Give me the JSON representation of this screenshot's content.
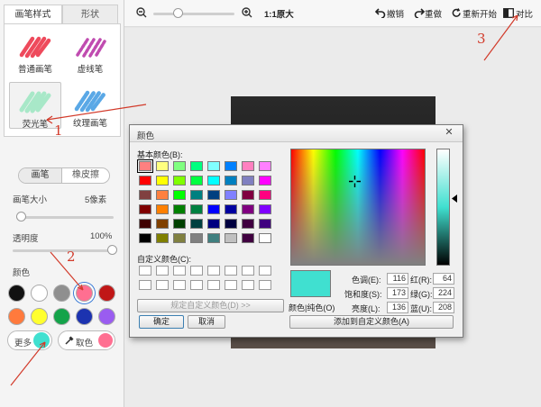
{
  "left_panel": {
    "tabs": [
      "画笔样式",
      "形状"
    ],
    "pens": [
      {
        "label": "普通画笔",
        "color": "#ee4a5c"
      },
      {
        "label": "虚线笔",
        "color": "#c04cb0"
      },
      {
        "label": "荧光笔",
        "color": "#a8e8c8"
      },
      {
        "label": "纹理画笔",
        "color": "#5aa8e6"
      }
    ],
    "mode_tabs": [
      "画笔",
      "橡皮擦"
    ],
    "size_label": "画笔大小",
    "size_value": "5像素",
    "size_fraction": 0.05,
    "opacity_label": "透明度",
    "opacity_value": "100%",
    "opacity_fraction": 1.0,
    "color_label": "颜色",
    "swatches": [
      "#111111",
      "#ffffff",
      "#8f8f8f",
      "#ff6f91",
      "#c01717",
      "#ff7a3d",
      "#ffff2e",
      "#14a34a",
      "#1c33b0",
      "#9a5cf0"
    ],
    "more_label": "更多",
    "more_color": "#40e0d0",
    "picker_label": "取色",
    "picker_color": "#ff6f91"
  },
  "toolbar": {
    "zoom_label": "1:1原大",
    "zoom_fraction": 0.3,
    "undo": "撤销",
    "redo": "重做",
    "restart": "重新开始",
    "compare": "对比"
  },
  "dialog": {
    "title": "颜色",
    "close_glyph": "✕",
    "basic_label": "基本颜色(B):",
    "basic_colors": [
      "#ff8080",
      "#ffff80",
      "#80ff80",
      "#00ff80",
      "#80ffff",
      "#0080ff",
      "#ff80c0",
      "#ff80ff",
      "#ff0000",
      "#ffff00",
      "#80ff00",
      "#00ff40",
      "#00ffff",
      "#0080c0",
      "#8080c0",
      "#ff00ff",
      "#804040",
      "#ff8040",
      "#00ff00",
      "#008080",
      "#004080",
      "#8080ff",
      "#800040",
      "#ff0080",
      "#800000",
      "#ff8000",
      "#008000",
      "#008040",
      "#0000ff",
      "#0000a0",
      "#800080",
      "#8000ff",
      "#400000",
      "#804000",
      "#004000",
      "#004040",
      "#000080",
      "#000040",
      "#400040",
      "#400080",
      "#000000",
      "#808000",
      "#808040",
      "#808080",
      "#408080",
      "#c0c0c0",
      "#400040",
      "#ffffff"
    ],
    "custom_label": "自定义颜色(C):",
    "define_button": "规定自定义颜色(D) >>",
    "ok_button": "确定",
    "cancel_button": "取消",
    "preview_label": "颜色|纯色(O)",
    "preview_color": "#40e0d0",
    "hue_label": "色调(E):",
    "hue_value": "116",
    "sat_label": "饱和度(S):",
    "sat_value": "173",
    "lum_label": "亮度(L):",
    "lum_value": "136",
    "red_label": "红(R):",
    "red_value": "64",
    "green_label": "绿(G):",
    "green_value": "224",
    "blue_label": "蓝(U):",
    "blue_value": "208",
    "add_custom_button": "添加到自定义颜色(A)"
  },
  "annotations": [
    "1",
    "2",
    "3"
  ]
}
